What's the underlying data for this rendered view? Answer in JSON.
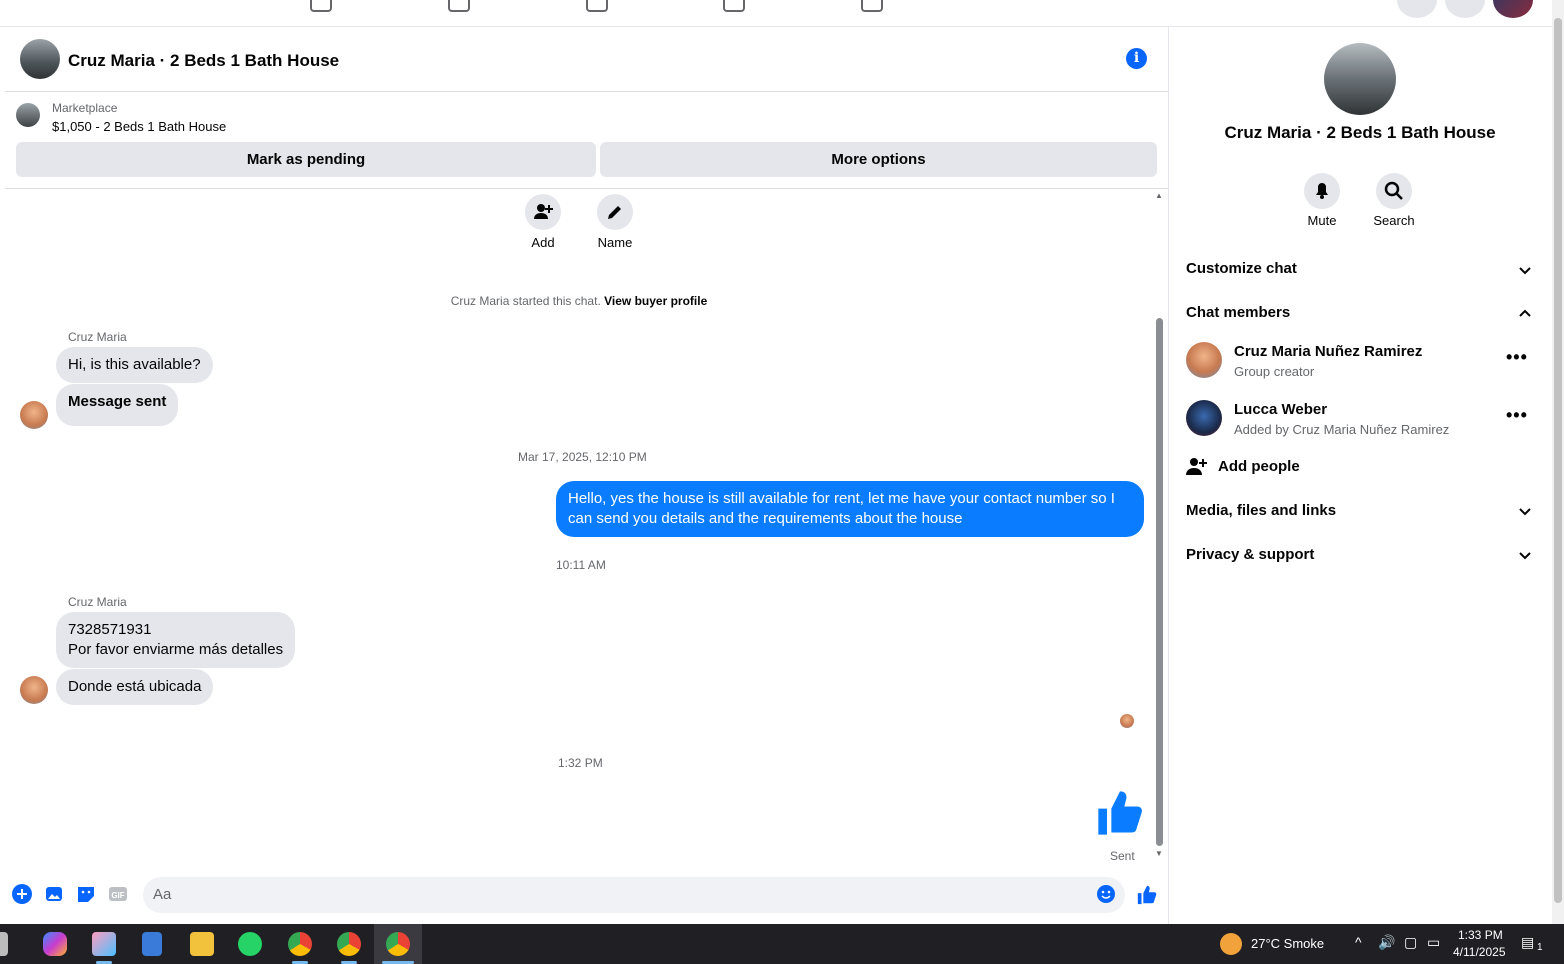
{
  "chat": {
    "title": "Cruz Maria · 2 Beds 1 Bath House",
    "info_icon": "i",
    "marketplace_label": "Marketplace",
    "listing": "$1,050 - 2 Beds 1 Bath House",
    "mark_pending": "Mark as pending",
    "more_options": "More options",
    "add_label": "Add",
    "name_label": "Name",
    "started_text": "Cruz Maria started this chat.",
    "view_buyer": "View buyer profile",
    "messages": [
      {
        "sender": "Cruz Maria",
        "text": "Hi, is this available?"
      },
      {
        "text": "Message sent"
      },
      {
        "timestamp": "Mar 17, 2025, 12:10 PM"
      },
      {
        "text": "Hello, yes the house is still available for rent, let me have your contact number so I can send you details and the requirements about the house"
      },
      {
        "timestamp": "10:11 AM"
      },
      {
        "sender": "Cruz Maria",
        "text_line1": "7328571931",
        "text_line2": "Por favor enviarme más detalles"
      },
      {
        "text": "Donde está ubicada"
      },
      {
        "timestamp": "1:32 PM"
      }
    ],
    "sent_label": "Sent",
    "composer_placeholder": "Aa"
  },
  "side": {
    "name": "Cruz Maria · 2 Beds 1 Bath House",
    "mute": "Mute",
    "search": "Search",
    "customize": "Customize chat",
    "members_header": "Chat members",
    "members": [
      {
        "name": "Cruz Maria Nuñez Ramirez",
        "sub": "Group creator"
      },
      {
        "name": "Lucca Weber",
        "sub": "Added by Cruz Maria Nuñez Ramirez"
      }
    ],
    "add_people": "Add people",
    "media": "Media, files and links",
    "privacy": "Privacy & support"
  },
  "taskbar": {
    "weather": "27°C  Smoke",
    "time": "1:33 PM",
    "date": "4/11/2025",
    "notif_count": "1"
  },
  "colors": {
    "accent": "#0866ff",
    "bubble_out": "#0a7cff",
    "bubble_in": "#e4e6eb"
  }
}
